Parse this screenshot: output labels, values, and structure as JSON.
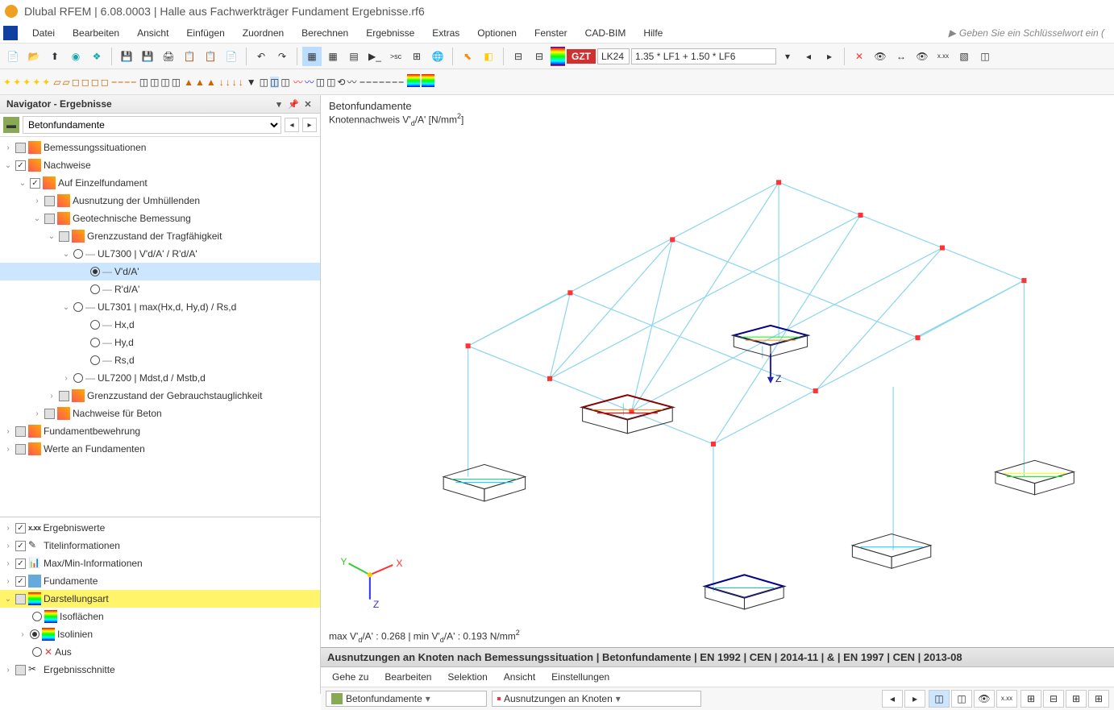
{
  "title": "Dlubal RFEM | 6.08.0003 | Halle aus Fachwerkträger Fundament Ergebnisse.rf6",
  "menu": [
    "Datei",
    "Bearbeiten",
    "Ansicht",
    "Einfügen",
    "Zuordnen",
    "Berechnen",
    "Ergebnisse",
    "Extras",
    "Optionen",
    "Fenster",
    "CAD-BIM",
    "Hilfe"
  ],
  "keyword_placeholder": "Geben Sie ein Schlüsselwort ein (",
  "loadcase": {
    "badge": "GZT",
    "name": "LK24",
    "desc": "1.35 * LF1 + 1.50 * LF6"
  },
  "navigator": {
    "title": "Navigator - Ergebnisse",
    "selector": "Betonfundamente",
    "tree": {
      "bemessungssituationen": "Bemessungssituationen",
      "nachweise": "Nachweise",
      "auf_einzel": "Auf Einzelfundament",
      "ausnutzung_umh": "Ausnutzung der Umhüllenden",
      "geotech": "Geotechnische Bemessung",
      "gzt": "Grenzzustand der Tragfähigkeit",
      "ul7300": "UL7300 | V'd/A' / R'd/A'",
      "vda": "V'd/A'",
      "rda": "R'd/A'",
      "ul7301": "UL7301 | max(Hx,d, Hy,d) / Rs,d",
      "hxd": "Hx,d",
      "hyd": "Hy,d",
      "rsd": "Rs,d",
      "ul7200": "UL7200 | Mdst,d / Mstb,d",
      "gzg": "Grenzzustand der Gebrauchstauglichkeit",
      "nachweise_beton": "Nachweise für Beton",
      "fundamentbewehrung": "Fundamentbewehrung",
      "werte_fund": "Werte an Fundamenten"
    },
    "bottom": {
      "ergebniswerte": "Ergebniswerte",
      "titelinfo": "Titelinformationen",
      "maxmin": "Max/Min-Informationen",
      "fundamente": "Fundamente",
      "darstellungsart": "Darstellungsart",
      "isoflaechen": "Isoflächen",
      "isolinien": "Isolinien",
      "aus": "Aus",
      "ergebnisschnitte": "Ergebnisschnitte"
    }
  },
  "viewport": {
    "line1": "Betonfundamente",
    "line2_pre": "Knotennachweis V'",
    "line2_sub": "d",
    "line2_mid": "/A' [N/mm",
    "line2_sup": "2",
    "line2_post": "]",
    "z_label": "Z",
    "coord": {
      "x": "X",
      "y": "Y",
      "z": "Z"
    },
    "footer_max_pre": "max V'",
    "footer_max_sub": "d",
    "footer_max_mid": "/A' : 0.268 | min V'",
    "footer_min_sub": "d",
    "footer_min_mid": "/A' : 0.193 N/mm",
    "footer_sup": "2"
  },
  "bottom_panel": {
    "title": "Ausnutzungen an Knoten nach Bemessungssituation | Betonfundamente | EN 1992 | CEN | 2014-11 | & | EN 1997 | CEN | 2013-08",
    "menu": [
      "Gehe zu",
      "Bearbeiten",
      "Selektion",
      "Ansicht",
      "Einstellungen"
    ],
    "sel1": "Betonfundamente",
    "sel2": "Ausnutzungen an Knoten"
  }
}
